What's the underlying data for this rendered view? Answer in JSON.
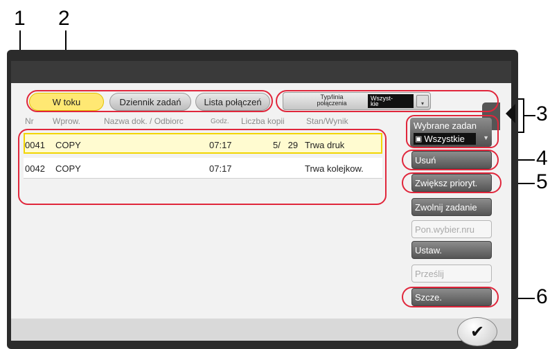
{
  "callouts": [
    "1",
    "2",
    "3",
    "4",
    "5",
    "6"
  ],
  "tabs": [
    {
      "label": "W toku",
      "state": "active"
    },
    {
      "label": "Dziennik zadań",
      "state": "inactive"
    },
    {
      "label": "Lista połączeń",
      "state": "inactive"
    }
  ],
  "filter": {
    "label": "Typ/linia\npołączenia",
    "value": "Wszyst-\nkie"
  },
  "columns": [
    "Nr",
    "Wprow.",
    "Nazwa dok. / Odbiorc",
    "Godz.",
    "Liczba kopii",
    "Stan/Wynik"
  ],
  "rows": [
    {
      "nr": "0041",
      "wprow": "COPY",
      "nazwa": "",
      "godz": "07:17",
      "kopie": "5/   29",
      "stan": "Trwa druk",
      "selected": true
    },
    {
      "nr": "0042",
      "wprow": "COPY",
      "nazwa": "",
      "godz": "07:17",
      "kopie": "",
      "stan": "Trwa kolejkow.",
      "selected": false
    }
  ],
  "selected_jobs": {
    "label": "Wybrane zadan",
    "value": "Wszystkie"
  },
  "side_buttons": [
    {
      "label": "Usuń",
      "enabled": true
    },
    {
      "label": "Zwiększ prioryt.",
      "enabled": true
    },
    {
      "label": "Zwolnij zadanie",
      "enabled": true
    },
    {
      "label": "Pon.wybier.nru",
      "enabled": false
    },
    {
      "label": "Ustaw.",
      "enabled": true
    },
    {
      "label": "Prześlij",
      "enabled": false
    },
    {
      "label": "Szcze.",
      "enabled": true
    }
  ],
  "colors": {
    "highlight": "#e0263b",
    "active_tab": "#ffe873",
    "selected_row": "#fffbd0"
  },
  "icons": [
    "stack-icon",
    "dropdown-arrow-icon",
    "panel-toggle-arrow-icon",
    "checkmark-icon"
  ]
}
